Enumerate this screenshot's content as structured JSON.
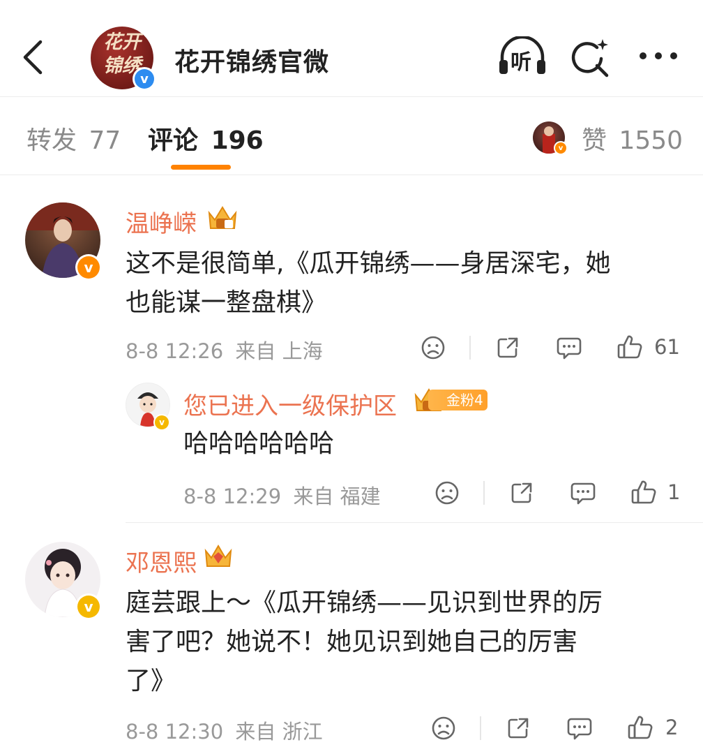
{
  "header": {
    "account_name": "花开锦绣官微",
    "avatar_logo": "花开锦绣",
    "listen_label": "听",
    "icons": [
      "back-arrow-icon",
      "headphones-icon",
      "search-sparkle-icon",
      "more-dots-icon"
    ]
  },
  "tabs": {
    "repost_label": "转发",
    "repost_count": "77",
    "comment_label": "评论",
    "comment_count": "196",
    "like_label": "赞",
    "like_count": "1550"
  },
  "colors": {
    "accent": "#ff8200",
    "username": "#eb7350",
    "meta": "#999999",
    "verified_blue": "#2d8cf0",
    "verified_orange": "#ff8a00"
  },
  "comments": [
    {
      "username": "温峥嵘",
      "text": "这不是很简单,《瓜开锦绣——身居深宅，她也能谋一整盘棋》",
      "line1": "这不是很简单,《瓜开锦绣——身居深宅，她",
      "line2": "也能谋一整盘棋》",
      "date": "8-8 12:26",
      "source": "来自 上海",
      "likes": "61",
      "reply": {
        "username": "您已进入一级保护区",
        "fan_badge": "金粉4",
        "text": "哈哈哈哈哈哈",
        "date": "8-8 12:29",
        "source": "来自 福建",
        "likes": "1"
      }
    },
    {
      "username": "邓恩熙",
      "text": "庭芸跟上～《瓜开锦绣——见识到世界的厉害了吧？她说不！她见识到她自己的厉害了》",
      "line1": "庭芸跟上～《瓜开锦绣——见识到世界的厉",
      "line2": "害了吧？她说不！她见识到她自己的厉害",
      "line3": "了》",
      "date": "8-8 12:30",
      "source": "来自 浙江",
      "likes": "2"
    }
  ]
}
